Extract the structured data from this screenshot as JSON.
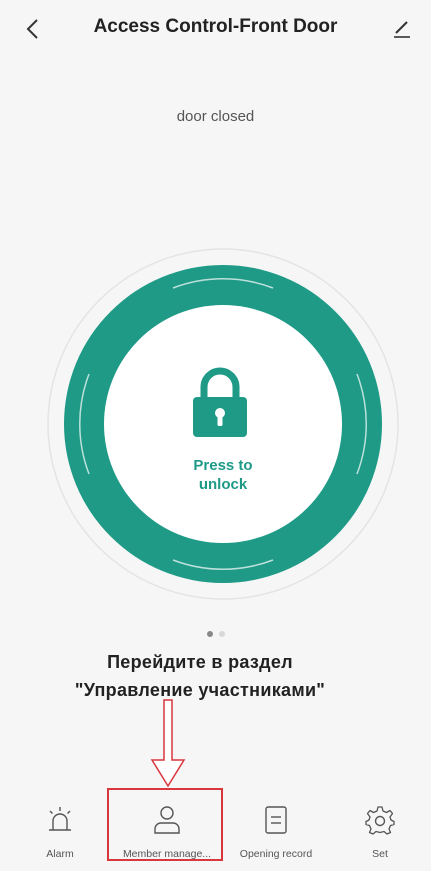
{
  "header": {
    "title": "Access Control-Front Door",
    "back_icon": "chevron-left-icon",
    "edit_icon": "pencil-icon"
  },
  "status": {
    "text": "door closed"
  },
  "unlock": {
    "icon": "lock-icon",
    "label_line1": "Press to",
    "label_line2": "unlock"
  },
  "pagination": {
    "total": 2,
    "active": 1
  },
  "annotation": {
    "line1": "Перейдите в раздел",
    "line2": "\"Управление участниками\"",
    "highlight_target": "Member manage...",
    "color": "#d9363e"
  },
  "tabs": [
    {
      "label": "Alarm",
      "icon": "alarm-icon"
    },
    {
      "label": "Member manage...",
      "icon": "person-icon"
    },
    {
      "label": "Opening record",
      "icon": "document-icon"
    },
    {
      "label": "Set",
      "icon": "gear-icon"
    }
  ],
  "colors": {
    "accent": "#1e9a87",
    "background": "#f6f6f6"
  }
}
